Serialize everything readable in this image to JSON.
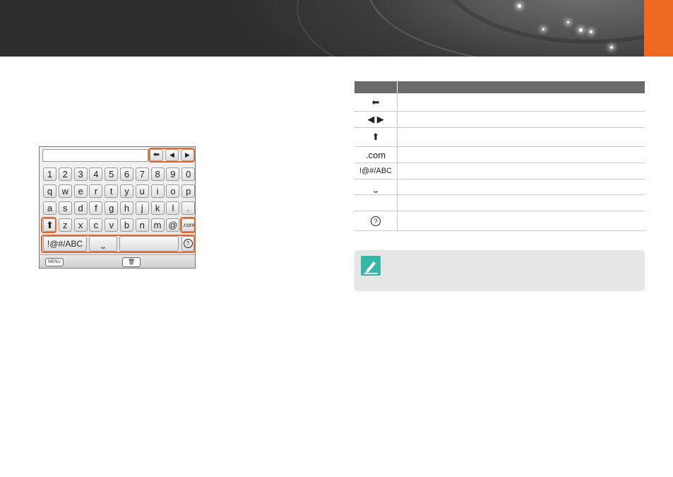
{
  "banner": {
    "accent_color": "#ee6a22"
  },
  "keyboard": {
    "rows": [
      [
        "1",
        "2",
        "3",
        "4",
        "5",
        "6",
        "7",
        "8",
        "9",
        "0"
      ],
      [
        "q",
        "w",
        "e",
        "r",
        "t",
        "y",
        "u",
        "i",
        "o",
        "p"
      ],
      [
        "a",
        "s",
        "d",
        "f",
        "g",
        "h",
        "j",
        "k",
        "l",
        "."
      ],
      [
        "⬆",
        "z",
        "x",
        "c",
        "v",
        "b",
        "n",
        "m",
        "@",
        ".com"
      ]
    ],
    "symbol_key": "!@#/ABC",
    "help_key": "?",
    "menu_label": "MENU",
    "nav_icons": [
      "backspace-arrow-icon",
      "left-arrow-icon",
      "right-arrow-icon"
    ]
  },
  "table": {
    "rows": [
      {
        "icon": "backspace-arrow-icon",
        "symbol": "⬅"
      },
      {
        "icon": "left-right-arrows-icon",
        "symbol": "◀ ▶"
      },
      {
        "icon": "shift-arrow-icon",
        "symbol": "⬆"
      },
      {
        "icon": "dotcom-text",
        "symbol": ".com"
      },
      {
        "icon": "symbols-text",
        "symbol": "!@#/ABC"
      },
      {
        "icon": "space-icon",
        "symbol": "⎵"
      },
      {
        "icon": "blank",
        "symbol": ""
      },
      {
        "icon": "help-icon",
        "symbol": "?"
      }
    ]
  },
  "note": {
    "badge_color": "#39b5aa"
  }
}
